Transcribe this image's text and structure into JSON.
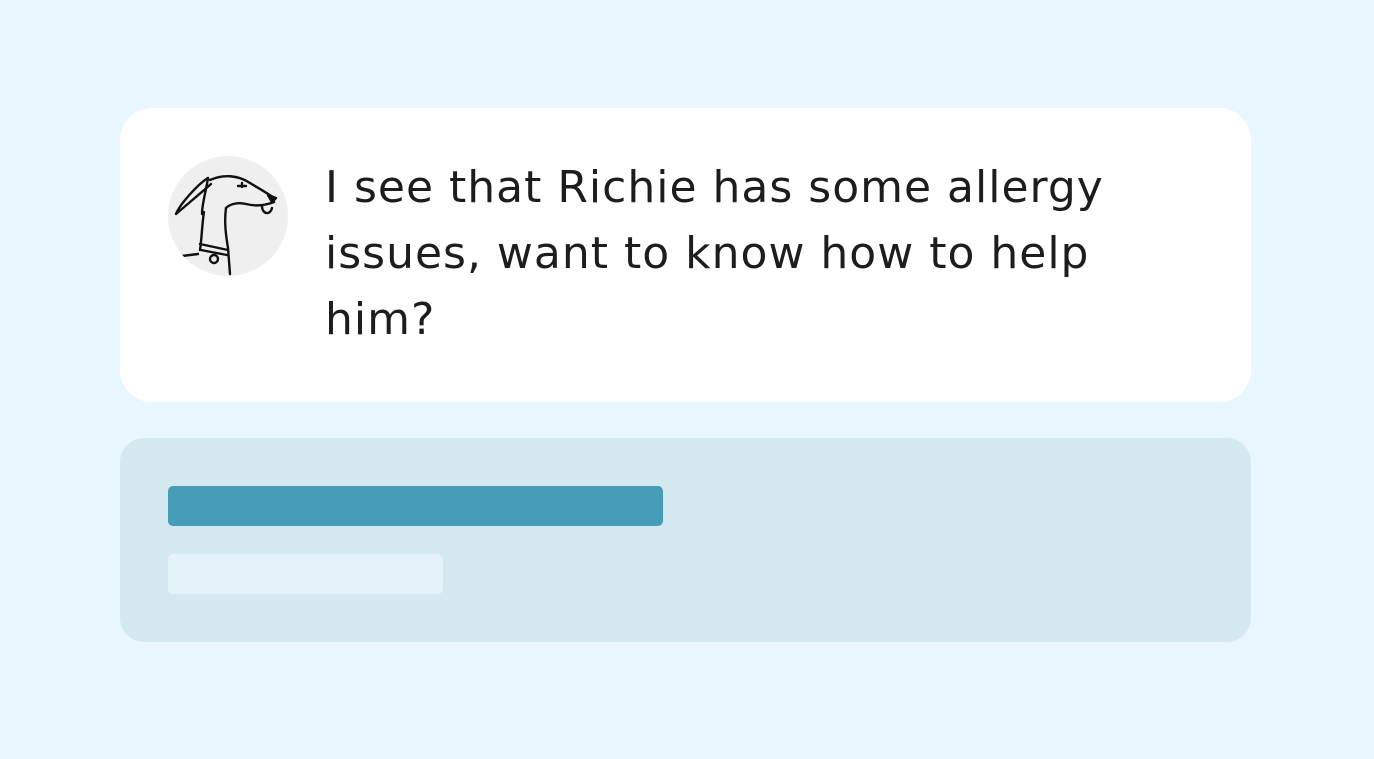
{
  "message": {
    "avatar_icon": "dog-mascot-icon",
    "text": "I see that Richie has some allergy issues, want to know how to help him?"
  },
  "skeleton": {
    "primary_color": "#459db7",
    "secondary_color": "#e3f3f8"
  },
  "colors": {
    "background": "#e8f7fd",
    "card": "#ffffff",
    "skeleton_card": "#d4e8ef",
    "text": "#1d1d1f"
  }
}
